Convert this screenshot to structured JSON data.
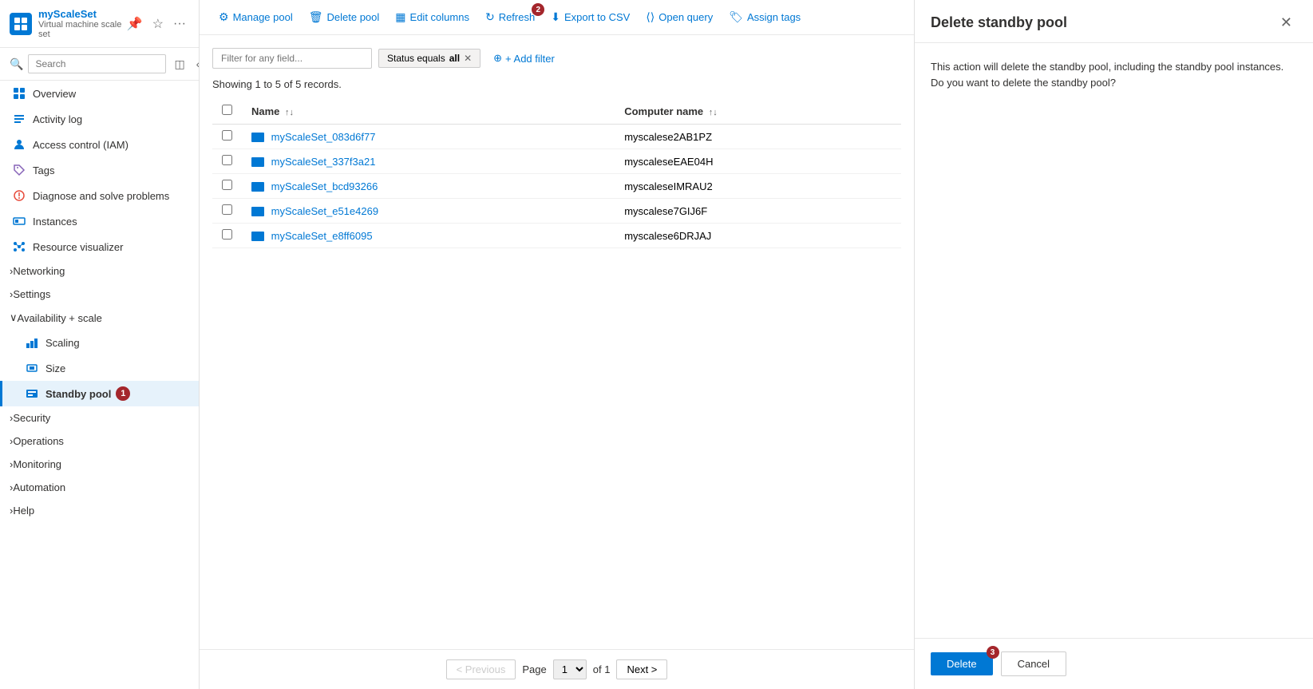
{
  "app": {
    "logo": "A",
    "resource_name": "myScaleSet",
    "resource_type": "Virtual machine scale set",
    "current_page": "Standby pool",
    "title_separator": "|"
  },
  "sidebar": {
    "search_placeholder": "Search",
    "nav_items": [
      {
        "id": "overview",
        "label": "Overview",
        "icon": "grid",
        "indent": 0
      },
      {
        "id": "activity-log",
        "label": "Activity log",
        "icon": "list",
        "indent": 0
      },
      {
        "id": "iam",
        "label": "Access control (IAM)",
        "icon": "person",
        "indent": 0
      },
      {
        "id": "tags",
        "label": "Tags",
        "icon": "tag",
        "indent": 0
      },
      {
        "id": "diagnose",
        "label": "Diagnose and solve problems",
        "icon": "wrench",
        "indent": 0
      },
      {
        "id": "instances",
        "label": "Instances",
        "icon": "server",
        "indent": 0
      },
      {
        "id": "resource-viz",
        "label": "Resource visualizer",
        "icon": "dots",
        "indent": 0
      },
      {
        "id": "networking",
        "label": "Networking",
        "icon": "chevron",
        "indent": 0
      },
      {
        "id": "settings",
        "label": "Settings",
        "icon": "chevron",
        "indent": 0
      },
      {
        "id": "availability",
        "label": "Availability + scale",
        "icon": "chevron-open",
        "indent": 0
      },
      {
        "id": "scaling",
        "label": "Scaling",
        "icon": "scale",
        "indent": 1
      },
      {
        "id": "size",
        "label": "Size",
        "icon": "size",
        "indent": 1
      },
      {
        "id": "standby-pool",
        "label": "Standby pool",
        "icon": "pool",
        "indent": 1,
        "active": true,
        "badge": "1"
      },
      {
        "id": "security",
        "label": "Security",
        "icon": "chevron",
        "indent": 0
      },
      {
        "id": "operations",
        "label": "Operations",
        "icon": "chevron",
        "indent": 0
      },
      {
        "id": "monitoring",
        "label": "Monitoring",
        "icon": "chevron",
        "indent": 0
      },
      {
        "id": "automation",
        "label": "Automation",
        "icon": "chevron",
        "indent": 0
      },
      {
        "id": "help",
        "label": "Help",
        "icon": "chevron",
        "indent": 0
      }
    ]
  },
  "toolbar": {
    "manage_pool": "Manage pool",
    "delete_pool": "Delete pool",
    "edit_columns": "Edit columns",
    "refresh": "Refresh",
    "export_csv": "Export to CSV",
    "open_query": "Open query",
    "assign_tags": "Assign tags",
    "refresh_badge": "2"
  },
  "filter": {
    "placeholder": "Filter for any field...",
    "active_filter_label": "Status equals",
    "active_filter_value": "all",
    "add_filter_label": "+ Add filter"
  },
  "table": {
    "record_count": "Showing 1 to 5 of 5 records.",
    "columns": [
      {
        "id": "name",
        "label": "Name",
        "sortable": true
      },
      {
        "id": "computer_name",
        "label": "Computer name",
        "sortable": true
      }
    ],
    "rows": [
      {
        "id": "row1",
        "name": "myScaleSet_083d6f77",
        "computer_name": "myscalese2AB1PZ"
      },
      {
        "id": "row2",
        "name": "myScaleSet_337f3a21",
        "computer_name": "myscaleseEAE04H"
      },
      {
        "id": "row3",
        "name": "myScaleSet_bcd93266",
        "computer_name": "myscaleseIMRAU2"
      },
      {
        "id": "row4",
        "name": "myScaleSet_e51e4269",
        "computer_name": "myscalese7GIJ6F"
      },
      {
        "id": "row5",
        "name": "myScaleSet_e8ff6095",
        "computer_name": "myscalese6DRJAJ"
      }
    ]
  },
  "pagination": {
    "prev_label": "< Previous",
    "next_label": "Next >",
    "page_label": "Page",
    "of_label": "of 1",
    "current_page": "1"
  },
  "delete_panel": {
    "title": "Delete standby pool",
    "description": "This action will delete the standby pool, including the standby pool instances. Do you want to delete the standby pool?",
    "delete_label": "Delete",
    "cancel_label": "Cancel",
    "badge": "3"
  }
}
